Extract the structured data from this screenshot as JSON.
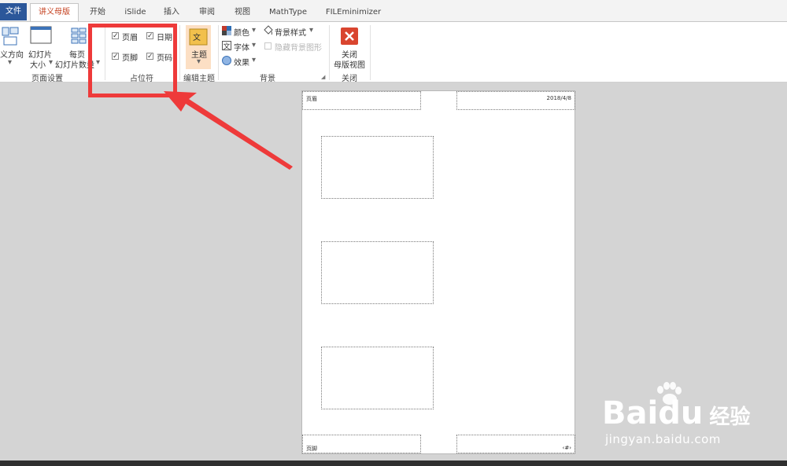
{
  "tabs": {
    "file": "文件",
    "handout_master": "讲义母版",
    "home": "开始",
    "islide": "iSlide",
    "insert": "插入",
    "review": "审阅",
    "view": "视图",
    "mathtype": "MathType",
    "fileminimizer": "FILEminimizer"
  },
  "ribbon": {
    "page_setup": {
      "orientation_label": "义方向",
      "slide_size_line1": "幻灯片",
      "slide_size_line2": "大小",
      "per_page_line1": "每页",
      "per_page_line2": "幻灯片数量",
      "group_label": "页面设置"
    },
    "placeholders": {
      "header": "页眉",
      "date": "日期",
      "footer": "页脚",
      "page_number": "页码",
      "header_checked": true,
      "date_checked": true,
      "footer_checked": true,
      "page_number_checked": true,
      "group_label": "占位符"
    },
    "edit_theme": {
      "theme_label": "主题",
      "group_label": "编辑主题"
    },
    "background": {
      "colors": "颜色",
      "fonts": "字体",
      "effects": "效果",
      "bg_styles": "背景样式",
      "hide_bg": "隐藏背景图形",
      "group_label": "背景"
    },
    "close": {
      "line1": "关闭",
      "line2": "母版视图",
      "group_label": "关闭"
    }
  },
  "page": {
    "header_text": "页眉",
    "date_text": "2018/4/8",
    "footer_text": "页脚",
    "page_number_text": "‹#›",
    "slide_count": 3
  },
  "watermark": {
    "brand": "Bai",
    "brand2": "du",
    "cn": "经验",
    "url": "jingyan.baidu.com"
  },
  "colors": {
    "accent": "#c43e1c",
    "highlight": "#ee3a3a",
    "file_tab": "#2b579a"
  }
}
